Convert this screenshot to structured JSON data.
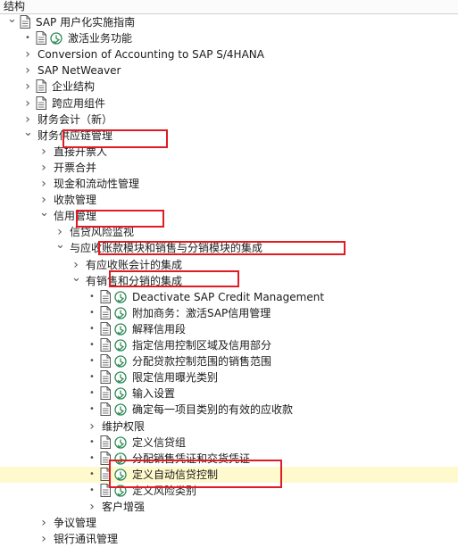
{
  "header": {
    "title": "结构"
  },
  "tree": [
    {
      "label": "SAP 用户化实施指南",
      "level": 0,
      "toggle": "expanded",
      "icons": [
        "doc"
      ]
    },
    {
      "label": "激活业务功能",
      "level": 1,
      "toggle": "bullet",
      "icons": [
        "doc",
        "clock"
      ]
    },
    {
      "label": "Conversion of Accounting to SAP S/4HANA",
      "level": 1,
      "toggle": "collapsed",
      "icons": []
    },
    {
      "label": "SAP NetWeaver",
      "level": 1,
      "toggle": "collapsed",
      "icons": []
    },
    {
      "label": "企业结构",
      "level": 1,
      "toggle": "collapsed",
      "icons": [
        "doc"
      ]
    },
    {
      "label": "跨应用组件",
      "level": 1,
      "toggle": "collapsed",
      "icons": [
        "doc"
      ]
    },
    {
      "label": "财务会计（新）",
      "level": 1,
      "toggle": "collapsed",
      "icons": []
    },
    {
      "label": "财务供应链管理",
      "level": 1,
      "toggle": "expanded",
      "icons": []
    },
    {
      "label": "直接开票人",
      "level": 2,
      "toggle": "collapsed",
      "icons": []
    },
    {
      "label": "开票合并",
      "level": 2,
      "toggle": "collapsed",
      "icons": []
    },
    {
      "label": "现金和流动性管理",
      "level": 2,
      "toggle": "collapsed",
      "icons": []
    },
    {
      "label": "收款管理",
      "level": 2,
      "toggle": "collapsed",
      "icons": []
    },
    {
      "label": "信用管理",
      "level": 2,
      "toggle": "expanded",
      "icons": []
    },
    {
      "label": "信贷风险监视",
      "level": 3,
      "toggle": "collapsed",
      "icons": []
    },
    {
      "label": "与应收账款模块和销售与分销模块的集成",
      "level": 3,
      "toggle": "expanded",
      "icons": []
    },
    {
      "label": "有应收账会计的集成",
      "level": 4,
      "toggle": "collapsed",
      "icons": []
    },
    {
      "label": "有销售和分销的集成",
      "level": 4,
      "toggle": "expanded",
      "icons": []
    },
    {
      "label": "Deactivate SAP Credit Management",
      "level": 5,
      "toggle": "bullet",
      "icons": [
        "doc",
        "clock"
      ]
    },
    {
      "label": "附加商务：激活SAP信用管理",
      "level": 5,
      "toggle": "bullet",
      "icons": [
        "doc",
        "clock"
      ]
    },
    {
      "label": "解释信用段",
      "level": 5,
      "toggle": "bullet",
      "icons": [
        "doc",
        "clock"
      ]
    },
    {
      "label": "指定信用控制区域及信用部分",
      "level": 5,
      "toggle": "bullet",
      "icons": [
        "doc",
        "clock"
      ]
    },
    {
      "label": "分配贷款控制范围的销售范围",
      "level": 5,
      "toggle": "bullet",
      "icons": [
        "doc",
        "clock"
      ]
    },
    {
      "label": "限定信用曝光类别",
      "level": 5,
      "toggle": "bullet",
      "icons": [
        "doc",
        "clock"
      ]
    },
    {
      "label": "输入设置",
      "level": 5,
      "toggle": "bullet",
      "icons": [
        "doc",
        "clock"
      ]
    },
    {
      "label": "确定每一项目类别的有效的应收款",
      "level": 5,
      "toggle": "bullet",
      "icons": [
        "doc",
        "clock"
      ]
    },
    {
      "label": "维护权限",
      "level": 5,
      "toggle": "collapsed",
      "icons": []
    },
    {
      "label": "定义信贷组",
      "level": 5,
      "toggle": "bullet",
      "icons": [
        "doc",
        "clock"
      ]
    },
    {
      "label": "分配销售凭证和交货凭证",
      "level": 5,
      "toggle": "bullet",
      "icons": [
        "doc",
        "clock"
      ]
    },
    {
      "label": "定义自动信贷控制",
      "level": 5,
      "toggle": "bullet",
      "icons": [
        "doc",
        "clock"
      ],
      "selected": true
    },
    {
      "label": "定义风险类别",
      "level": 5,
      "toggle": "bullet",
      "icons": [
        "doc",
        "clock"
      ]
    },
    {
      "label": "客户增强",
      "level": 5,
      "toggle": "collapsed",
      "icons": []
    },
    {
      "label": "争议管理",
      "level": 2,
      "toggle": "collapsed",
      "icons": []
    },
    {
      "label": "银行通讯管理",
      "level": 2,
      "toggle": "collapsed",
      "icons": []
    }
  ],
  "colors": {
    "highlight": "#e01b24",
    "selected_row": "#fffacd",
    "clock_icon": "#2e8b57"
  }
}
